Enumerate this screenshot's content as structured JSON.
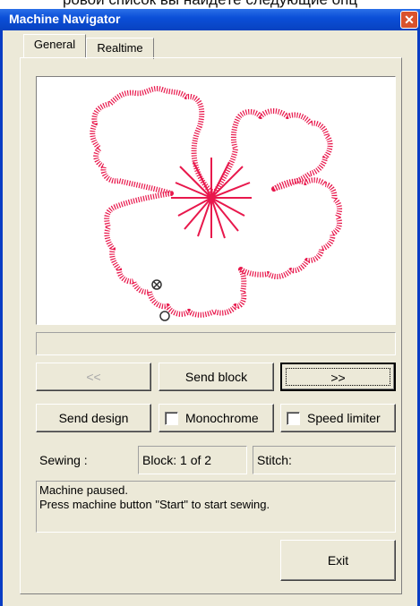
{
  "above_text": "ровой список вы найдёте следующие опц",
  "window": {
    "title": "Machine Navigator",
    "close_symbol": "✕"
  },
  "tabs": [
    {
      "label": "General"
    },
    {
      "label": "Realtime"
    }
  ],
  "navigation": {
    "prev_label": "<<",
    "send_block_label": "Send block",
    "next_label": ">>"
  },
  "options": {
    "send_design_label": "Send design",
    "monochrome_label": "Monochrome",
    "speed_limiter_label": "Speed limiter",
    "monochrome_checked": false,
    "speed_limiter_checked": false
  },
  "status": {
    "sewing_label": "Sewing :",
    "block_text": "Block: 1 of 2",
    "stitch_text": "Stitch:"
  },
  "message": "Machine paused.\nPress machine button \"Start\" to start sewing.",
  "exit_label": "Exit",
  "colors": {
    "thread": "#e8184c",
    "titlebar": "#0b4fd8",
    "face": "#ece9d8"
  },
  "icons": {
    "close": "close-icon",
    "needle_position": "needle-position-icon",
    "start_point": "start-point-icon"
  }
}
